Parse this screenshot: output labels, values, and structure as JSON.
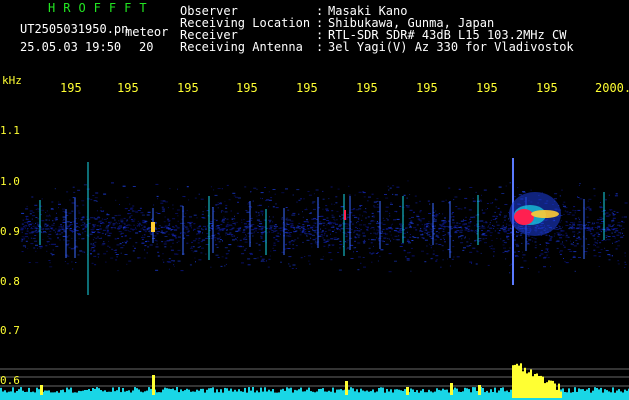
{
  "station": {
    "name": "HROFFFT"
  },
  "file": {
    "name": "UT2505031950.pn",
    "type_label": "meteor",
    "datetime": "25.05.03 19:50",
    "count": "20"
  },
  "header": {
    "rows": [
      {
        "label": "Observer",
        "value": "Masaki Kano"
      },
      {
        "label": "Receiving Location",
        "value": "Shibukawa, Gunma, Japan"
      },
      {
        "label": "Receiver",
        "value": "RTL-SDR SDR# 43dB L15 103.2MHz CW"
      },
      {
        "label": "Receiving Antenna",
        "value": "3el Yagi(V) Az 330 for Vladivostok"
      }
    ]
  },
  "axis": {
    "y_unit": "kHz",
    "y_ticks": [
      "1.1",
      "1.0",
      "0.9",
      "0.8",
      "0.7",
      "0.6"
    ],
    "x_ticks": [
      "195",
      "195",
      "195",
      "195",
      "195",
      "195",
      "195",
      "195",
      "195",
      "2000."
    ]
  },
  "colors": {
    "background": "#000000",
    "text": "#ffffff",
    "accent_yellow": "#ffff33",
    "accent_green": "#22e622",
    "signal_cyan": "#19d6e6",
    "noise_blue": "#1a2aa0",
    "meteor_red": "#ff2050"
  }
}
